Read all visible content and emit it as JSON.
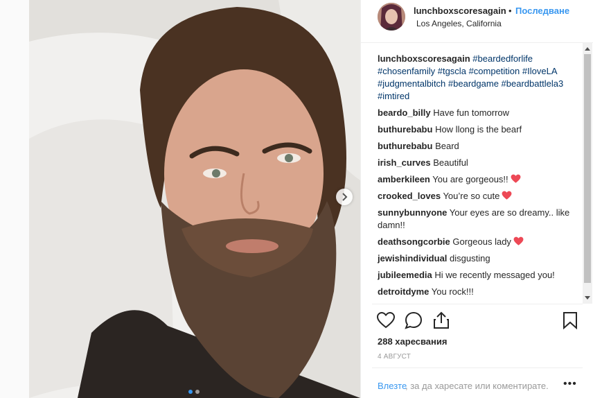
{
  "post": {
    "username": "lunchboxscoresagain",
    "separator": "•",
    "follow_label": "Последване",
    "location": "Los Angeles, California",
    "caption": {
      "username": "lunchboxscoresagain",
      "tags": [
        "#beardedforlife",
        "#chosenfamily",
        "#tgscla",
        "#competition",
        "#IloveLA",
        "#judgmentalbitch",
        "#beardgame",
        "#beardbattlela3",
        "#imtired"
      ]
    },
    "comments": [
      {
        "user": "beardo_billy",
        "text": "Have fun tomorrow",
        "heart": false
      },
      {
        "user": "buthurebabu",
        "text": "How llong is the bearf",
        "heart": false
      },
      {
        "user": "buthurebabu",
        "text": "Beard",
        "heart": false
      },
      {
        "user": "irish_curves",
        "text": "Beautiful",
        "heart": false
      },
      {
        "user": "amberkileen",
        "text": "You are gorgeous!!",
        "heart": true
      },
      {
        "user": "crooked_loves",
        "text": "You’re so cute",
        "heart": true
      },
      {
        "user": "sunnybunnyone",
        "text": "Your eyes are so dreamy.. like damn!!",
        "heart": false
      },
      {
        "user": "deathsongcorbie",
        "text": "Gorgeous lady",
        "heart": true
      },
      {
        "user": "jewishindividual",
        "text": "disgusting",
        "heart": false
      },
      {
        "user": "jubileemedia",
        "text": "Hi we recently messaged you!",
        "heart": false
      },
      {
        "user": "detroitdyme",
        "text": "You rock!!!",
        "heart": false
      }
    ],
    "likes_label": "288 харесвания",
    "date_label": "4 АВГУСТ",
    "login_link": "Влезте",
    "login_rest": ", за да харесате или коментирате.",
    "more_label": "•••",
    "carousel": {
      "current": 1,
      "total": 2
    }
  },
  "colors": {
    "accent": "#3897f0",
    "hashtag": "#003569",
    "heart": "#ed4956",
    "muted": "#999999"
  },
  "icons": [
    "heart-outline-icon",
    "comment-bubble-icon",
    "share-icon",
    "bookmark-icon",
    "chevron-right-icon",
    "red-heart-icon"
  ]
}
